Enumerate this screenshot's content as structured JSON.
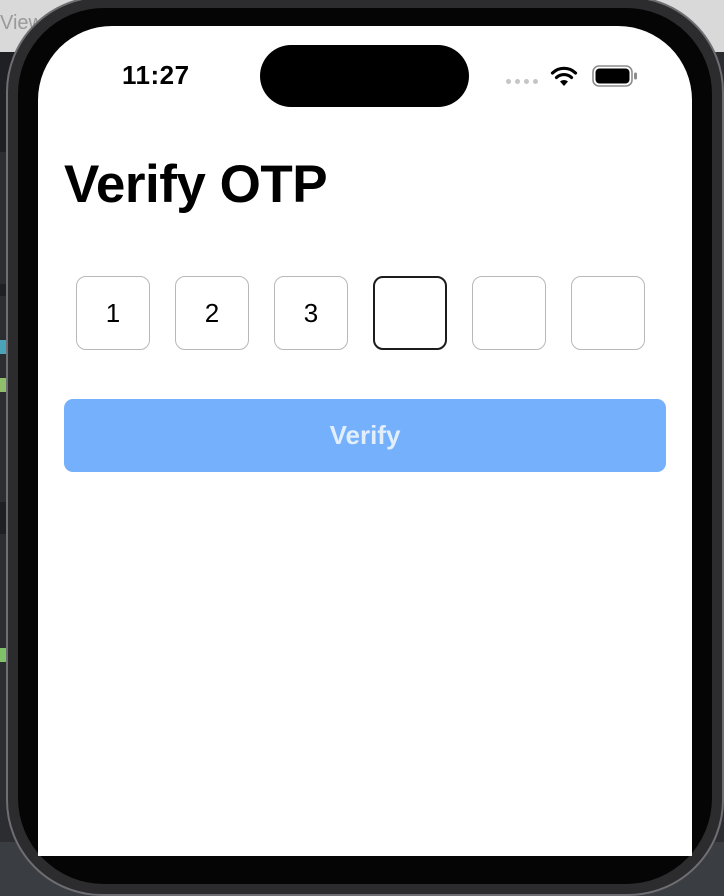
{
  "host": {
    "topbar_label": "View"
  },
  "status_bar": {
    "time": "11:27",
    "icons": [
      "cellular-signal-icon",
      "wifi-icon",
      "battery-icon"
    ]
  },
  "screen": {
    "title": "Verify OTP",
    "otp_digits": [
      "1",
      "2",
      "3",
      "",
      "",
      ""
    ],
    "active_index": 3,
    "verify_label": "Verify"
  },
  "colors": {
    "button_bg": "#74b0fb",
    "button_text": "#e3eefc",
    "box_border": "#b8b8bc",
    "active_border": "#1c1c1e"
  }
}
